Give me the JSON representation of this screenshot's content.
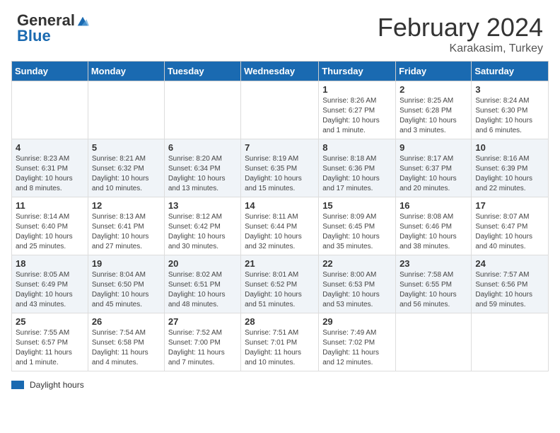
{
  "header": {
    "logo_general": "General",
    "logo_blue": "Blue",
    "title": "February 2024",
    "location": "Karakasim, Turkey"
  },
  "days_of_week": [
    "Sunday",
    "Monday",
    "Tuesday",
    "Wednesday",
    "Thursday",
    "Friday",
    "Saturday"
  ],
  "weeks": [
    {
      "shaded": false,
      "days": [
        {
          "number": "",
          "info": ""
        },
        {
          "number": "",
          "info": ""
        },
        {
          "number": "",
          "info": ""
        },
        {
          "number": "",
          "info": ""
        },
        {
          "number": "1",
          "info": "Sunrise: 8:26 AM\nSunset: 6:27 PM\nDaylight: 10 hours and 1 minute."
        },
        {
          "number": "2",
          "info": "Sunrise: 8:25 AM\nSunset: 6:28 PM\nDaylight: 10 hours and 3 minutes."
        },
        {
          "number": "3",
          "info": "Sunrise: 8:24 AM\nSunset: 6:30 PM\nDaylight: 10 hours and 6 minutes."
        }
      ]
    },
    {
      "shaded": true,
      "days": [
        {
          "number": "4",
          "info": "Sunrise: 8:23 AM\nSunset: 6:31 PM\nDaylight: 10 hours and 8 minutes."
        },
        {
          "number": "5",
          "info": "Sunrise: 8:21 AM\nSunset: 6:32 PM\nDaylight: 10 hours and 10 minutes."
        },
        {
          "number": "6",
          "info": "Sunrise: 8:20 AM\nSunset: 6:34 PM\nDaylight: 10 hours and 13 minutes."
        },
        {
          "number": "7",
          "info": "Sunrise: 8:19 AM\nSunset: 6:35 PM\nDaylight: 10 hours and 15 minutes."
        },
        {
          "number": "8",
          "info": "Sunrise: 8:18 AM\nSunset: 6:36 PM\nDaylight: 10 hours and 17 minutes."
        },
        {
          "number": "9",
          "info": "Sunrise: 8:17 AM\nSunset: 6:37 PM\nDaylight: 10 hours and 20 minutes."
        },
        {
          "number": "10",
          "info": "Sunrise: 8:16 AM\nSunset: 6:39 PM\nDaylight: 10 hours and 22 minutes."
        }
      ]
    },
    {
      "shaded": false,
      "days": [
        {
          "number": "11",
          "info": "Sunrise: 8:14 AM\nSunset: 6:40 PM\nDaylight: 10 hours and 25 minutes."
        },
        {
          "number": "12",
          "info": "Sunrise: 8:13 AM\nSunset: 6:41 PM\nDaylight: 10 hours and 27 minutes."
        },
        {
          "number": "13",
          "info": "Sunrise: 8:12 AM\nSunset: 6:42 PM\nDaylight: 10 hours and 30 minutes."
        },
        {
          "number": "14",
          "info": "Sunrise: 8:11 AM\nSunset: 6:44 PM\nDaylight: 10 hours and 32 minutes."
        },
        {
          "number": "15",
          "info": "Sunrise: 8:09 AM\nSunset: 6:45 PM\nDaylight: 10 hours and 35 minutes."
        },
        {
          "number": "16",
          "info": "Sunrise: 8:08 AM\nSunset: 6:46 PM\nDaylight: 10 hours and 38 minutes."
        },
        {
          "number": "17",
          "info": "Sunrise: 8:07 AM\nSunset: 6:47 PM\nDaylight: 10 hours and 40 minutes."
        }
      ]
    },
    {
      "shaded": true,
      "days": [
        {
          "number": "18",
          "info": "Sunrise: 8:05 AM\nSunset: 6:49 PM\nDaylight: 10 hours and 43 minutes."
        },
        {
          "number": "19",
          "info": "Sunrise: 8:04 AM\nSunset: 6:50 PM\nDaylight: 10 hours and 45 minutes."
        },
        {
          "number": "20",
          "info": "Sunrise: 8:02 AM\nSunset: 6:51 PM\nDaylight: 10 hours and 48 minutes."
        },
        {
          "number": "21",
          "info": "Sunrise: 8:01 AM\nSunset: 6:52 PM\nDaylight: 10 hours and 51 minutes."
        },
        {
          "number": "22",
          "info": "Sunrise: 8:00 AM\nSunset: 6:53 PM\nDaylight: 10 hours and 53 minutes."
        },
        {
          "number": "23",
          "info": "Sunrise: 7:58 AM\nSunset: 6:55 PM\nDaylight: 10 hours and 56 minutes."
        },
        {
          "number": "24",
          "info": "Sunrise: 7:57 AM\nSunset: 6:56 PM\nDaylight: 10 hours and 59 minutes."
        }
      ]
    },
    {
      "shaded": false,
      "days": [
        {
          "number": "25",
          "info": "Sunrise: 7:55 AM\nSunset: 6:57 PM\nDaylight: 11 hours and 1 minute."
        },
        {
          "number": "26",
          "info": "Sunrise: 7:54 AM\nSunset: 6:58 PM\nDaylight: 11 hours and 4 minutes."
        },
        {
          "number": "27",
          "info": "Sunrise: 7:52 AM\nSunset: 7:00 PM\nDaylight: 11 hours and 7 minutes."
        },
        {
          "number": "28",
          "info": "Sunrise: 7:51 AM\nSunset: 7:01 PM\nDaylight: 11 hours and 10 minutes."
        },
        {
          "number": "29",
          "info": "Sunrise: 7:49 AM\nSunset: 7:02 PM\nDaylight: 11 hours and 12 minutes."
        },
        {
          "number": "",
          "info": ""
        },
        {
          "number": "",
          "info": ""
        }
      ]
    }
  ],
  "legend": {
    "daylight_label": "Daylight hours"
  }
}
